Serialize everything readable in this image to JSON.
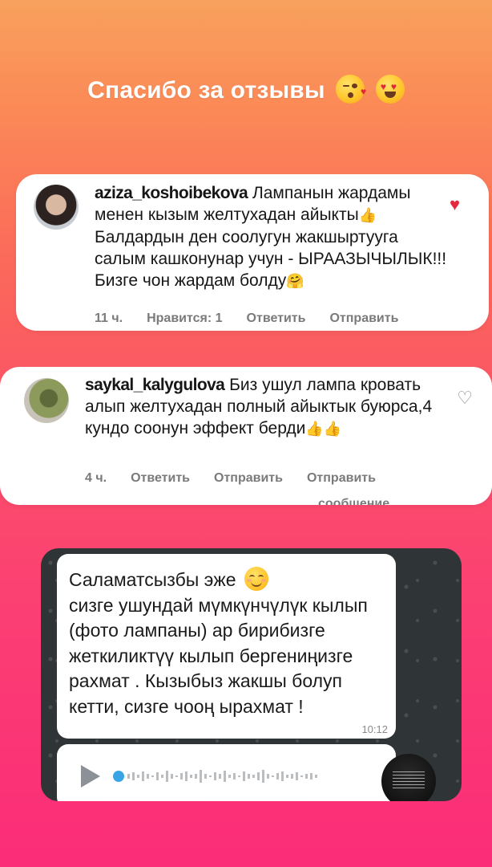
{
  "header": {
    "title": "Спасибо за отзывы",
    "emojis": [
      "kissing-heart-emoji",
      "heart-eyes-emoji"
    ]
  },
  "comments": [
    {
      "username": "aziza_koshoibekova",
      "text": "Лампанын жардамы менен кызым желтухадан айыкты",
      "text2": "Балдардын ден соолугун жакшыртууга салым кашконунар учун - ЫРААЗЫЧЫЛЫК!!! Бизге чон жардам болду",
      "time": "11 ч.",
      "likes": "Нравится: 1",
      "reply": "Ответить",
      "send": "Отправить",
      "liked": true
    },
    {
      "username": "saykal_kalygulova",
      "text": "Биз ушул лампа кровать алып желтухадан полный айыктык буюрса,4 кундо соонун эффект берди",
      "time": "4 ч.",
      "reply": "Ответить",
      "send": "Отправить",
      "send_message": "Отправить",
      "send_message_cut": "сообщение",
      "liked": false
    }
  ],
  "chat": {
    "greeting": "Саламатсызбы эже",
    "message": "сизге ушундай мүмкүнчүлүк кылып (фото лампаны) ар бирибизге жеткиликтүү кылып бергениңизге рахмат . Кызыбыз жакшы болуп кетти, сизге чооң ырахмат !",
    "time": "10:12"
  },
  "colors": {
    "like": "#e6273d",
    "voice_dot": "#3aa5e6",
    "gradient_top": "#f8a15d",
    "gradient_bottom": "#fb2c78"
  }
}
